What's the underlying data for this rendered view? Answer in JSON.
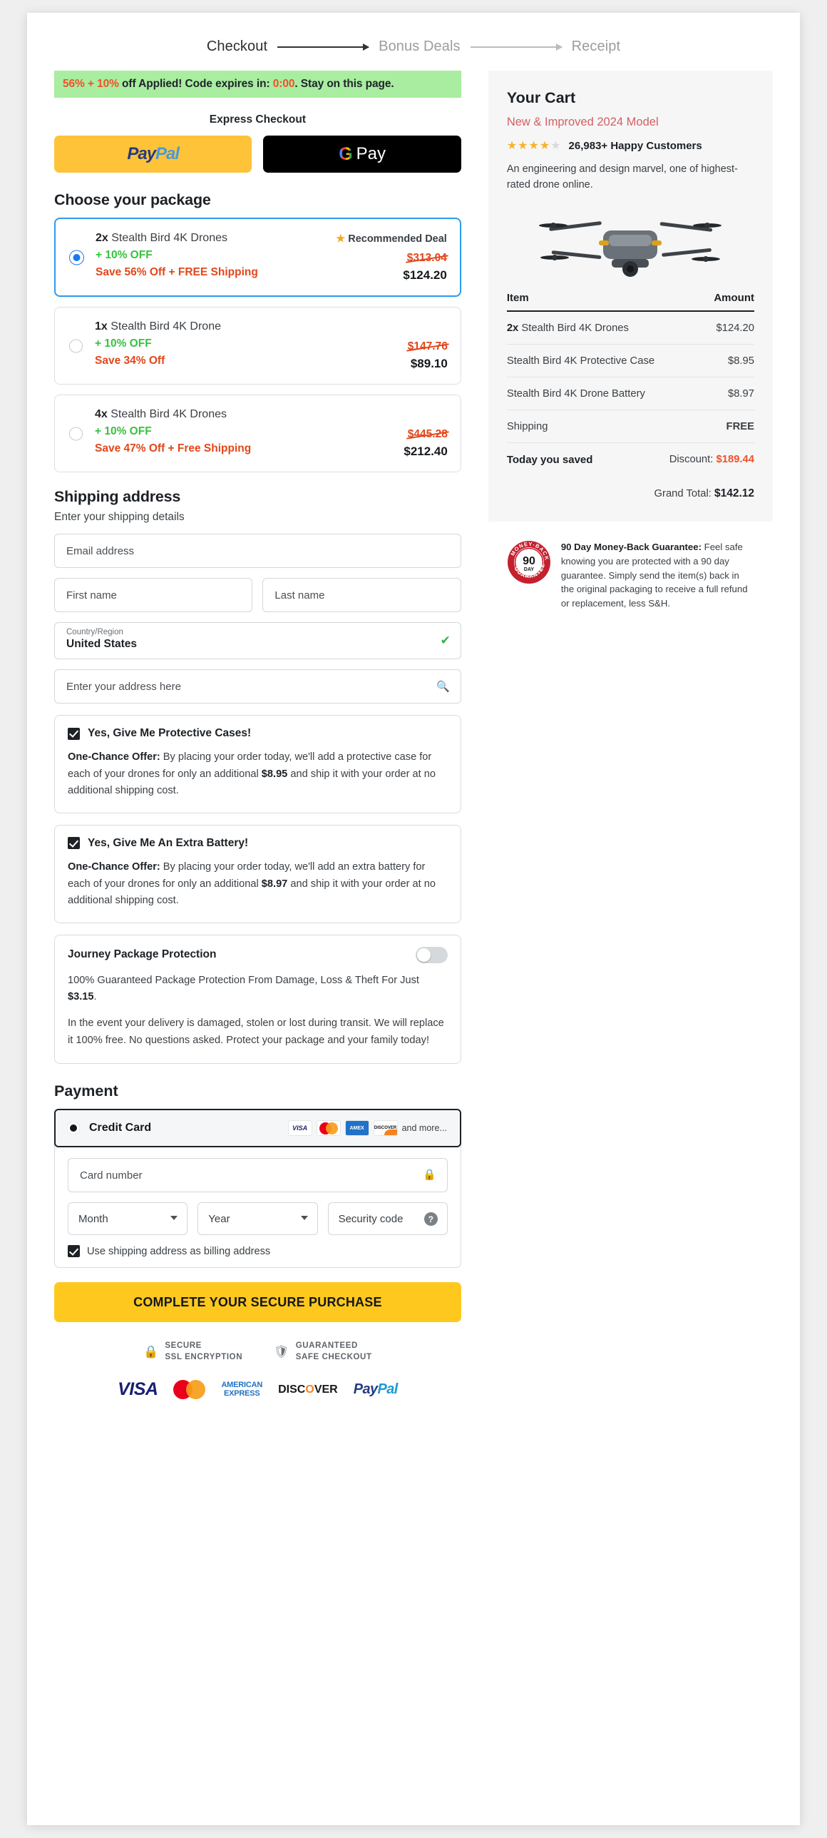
{
  "steps": [
    {
      "label": "Checkout",
      "active": true
    },
    {
      "label": "Bonus Deals",
      "active": false
    },
    {
      "label": "Receipt",
      "active": false
    }
  ],
  "promo": {
    "percent": "56% + 10%",
    "mid": " off Applied! Code expires in: ",
    "timer": "0:00",
    "tail": ". Stay on this page."
  },
  "express": {
    "title": "Express Checkout",
    "paypal_1": "Pay",
    "paypal_2": "Pal",
    "gpay_g": "G",
    "gpay_pay": "Pay"
  },
  "packages": {
    "title": "Choose your package",
    "recommended_badge": "Recommended Deal",
    "items": [
      {
        "qty": "2x",
        "name": " Stealth Bird 4K Drones",
        "extra": "+ 10% OFF",
        "save": "Save 56% Off + FREE Shipping",
        "price_old": "$313.04",
        "price_new": "$124.20",
        "selected": true,
        "recommended": true
      },
      {
        "qty": "1x",
        "name": " Stealth Bird 4K Drone",
        "extra": "+ 10% OFF",
        "save": "Save 34% Off",
        "price_old": "$147.76",
        "price_new": "$89.10",
        "selected": false,
        "recommended": false
      },
      {
        "qty": "4x",
        "name": " Stealth Bird 4K Drones",
        "extra": "+ 10% OFF",
        "save": "Save 47% Off + Free Shipping",
        "price_old": "$445.28",
        "price_new": "$212.40",
        "selected": false,
        "recommended": false
      }
    ]
  },
  "shipping": {
    "title": "Shipping address",
    "subtitle": "Enter your shipping details",
    "email_placeholder": "Email address",
    "first_placeholder": "First name",
    "last_placeholder": "Last name",
    "country_label": "Country/Region",
    "country_value": "United States",
    "address_placeholder": "Enter your address here"
  },
  "offers": [
    {
      "label": "Yes, Give Me Protective Cases!",
      "bold": "One-Chance Offer:",
      "text": " By placing your order today, we'll add a protective case for each of your drones for only an additional ",
      "amount": "$8.95",
      "tail": " and ship it with your order at no additional shipping cost.",
      "checked": true
    },
    {
      "label": "Yes, Give Me An Extra Battery!",
      "bold": "One-Chance Offer:",
      "text": " By placing your order today, we'll add an extra battery for each of your drones for only an additional ",
      "amount": "$8.97",
      "tail": " and ship it with your order at no additional shipping cost.",
      "checked": true
    }
  ],
  "protection": {
    "title": "Journey Package Protection",
    "p1_a": "100% Guaranteed Package Protection From Damage, Loss & Theft For Just ",
    "p1_price": "$3.15",
    "p1_b": ".",
    "p2": "In the event your delivery is damaged, stolen or lost during transit. We will replace it 100% free. No questions asked. Protect your package and your family today!",
    "enabled": false
  },
  "payment": {
    "title": "Payment",
    "method_label": "Credit Card",
    "and_more": "and more...",
    "card_placeholder": "Card number",
    "month_value": "Month",
    "year_value": "Year",
    "security_placeholder": "Security code",
    "billing_label": "Use shipping address as billing address",
    "billing_checked": true,
    "cta": "COMPLETE YOUR SECURE PURCHASE"
  },
  "trust": [
    {
      "line1": "SECURE",
      "line2": "SSL ENCRYPTION",
      "icon": "lock-icon"
    },
    {
      "line1": "GUARANTEED",
      "line2": "SAFE CHECKOUT",
      "icon": "shield-icon"
    }
  ],
  "footer_cards": {
    "visa": "VISA",
    "amex_1": "AMERICAN",
    "amex_2": "EXPRESS",
    "disc_a": "DISC",
    "disc_o": "O",
    "disc_b": "VER",
    "pp_a": "Pay",
    "pp_b": "Pal"
  },
  "cart": {
    "title": "Your Cart",
    "model": "New & Improved 2024 Model",
    "stars_full": "★★★★",
    "stars_half": "★",
    "happy": "26,983+ Happy Customers",
    "desc": "An engineering and design marvel, one of highest-rated drone online.",
    "col_item": "Item",
    "col_amount": "Amount",
    "rows": [
      {
        "qty": "2x",
        "label": " Stealth Bird 4K Drones",
        "amount": "$124.20",
        "bold_qty": true
      },
      {
        "qty": "",
        "label": "Stealth Bird 4K Protective Case",
        "amount": "$8.95",
        "bold_qty": false
      },
      {
        "qty": "",
        "label": "Stealth Bird 4K Drone Battery",
        "amount": "$8.97",
        "bold_qty": false
      },
      {
        "qty": "",
        "label": "Shipping",
        "amount": "FREE",
        "bold_qty": false,
        "free": true
      }
    ],
    "saved_label": "Today you saved",
    "discount_label": "Discount: ",
    "discount_amount": "$189.44",
    "grand_label": "Grand Total: ",
    "grand_amount": "$142.12"
  },
  "guarantee": {
    "seal_num": "90",
    "seal_day": "DAY",
    "seal_top": "MONEY-BACK",
    "seal_bottom": "GUARANTEE",
    "bold": "90 Day Money-Back Guarantee:",
    "text": " Feel safe knowing you are protected with a 90 day guarantee. Simply send the item(s) back in the original packaging to receive a full refund or replacement, less S&H."
  },
  "colors": {
    "accent_orange": "#f0512a",
    "green_banner": "#a8eda0",
    "blue_selected": "#2e9bf0",
    "cta_yellow": "#ffc81f"
  }
}
